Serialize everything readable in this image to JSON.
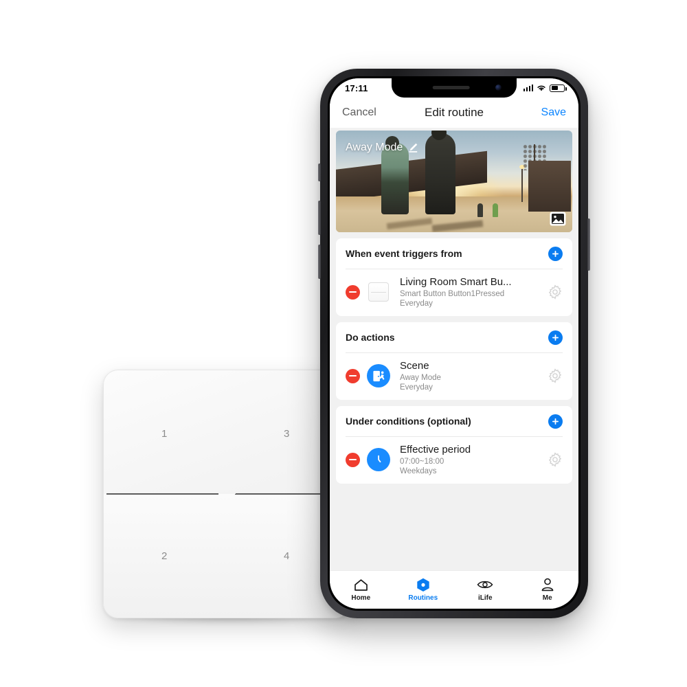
{
  "product_photo": {
    "device": {
      "name": "4-button smart wall switch",
      "button_labels": [
        "1",
        "3",
        "2",
        "4"
      ]
    }
  },
  "phone": {
    "status_bar": {
      "time": "17:11",
      "signal_icon": "cellular-bars-icon",
      "wifi_icon": "wifi-icon",
      "battery_icon": "battery-icon",
      "battery_level_percent": 45
    },
    "nav_bar": {
      "cancel_label": "Cancel",
      "title": "Edit routine",
      "save_label": "Save"
    },
    "hero": {
      "title": "Away Mode",
      "edit_icon": "pencil-edit-icon",
      "photo_picker_icon": "image-picker-icon"
    },
    "sections": [
      {
        "heading": "When event triggers from",
        "add_icon": "plus-circle-icon",
        "rows": [
          {
            "remove_icon": "minus-circle-icon",
            "thumb_icon": "smart-button-device-icon",
            "title": "Living Room Smart Bu...",
            "subtitle_1": "Smart Button Button1Pressed",
            "subtitle_2": "Everyday",
            "settings_icon": "gear-icon"
          }
        ]
      },
      {
        "heading": "Do actions",
        "add_icon": "plus-circle-icon",
        "rows": [
          {
            "remove_icon": "minus-circle-icon",
            "thumb_icon": "scene-exit-door-icon",
            "title": "Scene",
            "subtitle_1": "Away Mode",
            "subtitle_2": "Everyday",
            "settings_icon": "gear-icon"
          }
        ]
      },
      {
        "heading": "Under conditions (optional)",
        "add_icon": "plus-circle-icon",
        "rows": [
          {
            "remove_icon": "minus-circle-icon",
            "thumb_icon": "clock-icon",
            "title": "Effective period",
            "subtitle_1": "07:00~18:00",
            "subtitle_2": "Weekdays",
            "settings_icon": "gear-icon"
          }
        ]
      }
    ],
    "tab_bar": {
      "tabs": [
        {
          "label": "Home",
          "icon": "home-icon",
          "active": false
        },
        {
          "label": "Routines",
          "icon": "hexagon-icon",
          "active": true
        },
        {
          "label": "iLife",
          "icon": "eye-icon",
          "active": false
        },
        {
          "label": "Me",
          "icon": "person-icon",
          "active": false
        }
      ]
    }
  },
  "colors": {
    "accent_blue": "#0a7cf0",
    "link_blue": "#0a84ff",
    "remove_red": "#f03c2e",
    "icon_blue": "#1a8cff",
    "screen_bg": "#f1f1f1"
  }
}
